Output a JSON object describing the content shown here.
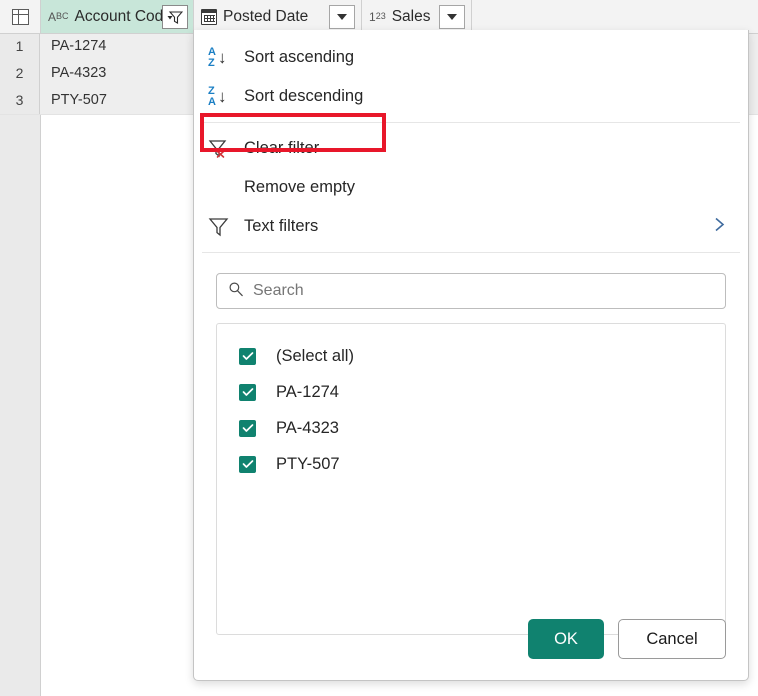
{
  "colors": {
    "accent_teal": "#10826f",
    "active_column_header": "#c8e6d9",
    "highlight_red": "#e8172a",
    "sort_letter_blue": "#1b7fc4",
    "clear_filter_x_red": "#d13438"
  },
  "grid": {
    "corner_icon": "table-icon",
    "columns": [
      {
        "type_icon": "abc-text-type-icon",
        "label": "Account Code",
        "button": "filter-funnel-dropdown",
        "active": true
      },
      {
        "type_icon": "calendar-date-type-icon",
        "label": "Posted Date",
        "button": "dropdown-caret",
        "active": false
      },
      {
        "type_icon": "123-number-type-icon",
        "label": "Sales",
        "button": "dropdown-caret",
        "active": false
      }
    ],
    "rows": [
      {
        "number": "1",
        "account_code": "PA-1274"
      },
      {
        "number": "2",
        "account_code": "PA-4323"
      },
      {
        "number": "3",
        "account_code": "PTY-507"
      }
    ]
  },
  "filter_panel": {
    "menu": [
      {
        "icon": "sort-ascending-icon",
        "label": "Sort ascending",
        "letters_top": "A",
        "letters_bottom": "Z",
        "arrow": "↓"
      },
      {
        "icon": "sort-descending-icon",
        "label": "Sort descending",
        "letters_top": "Z",
        "letters_bottom": "A",
        "arrow": "↓"
      },
      {
        "icon": "clear-filter-icon",
        "label": "Clear filter",
        "highlighted": true
      },
      {
        "icon": "none",
        "label": "Remove empty"
      },
      {
        "icon": "funnel-icon",
        "label": "Text filters",
        "submenu_chevron": "›"
      }
    ],
    "search": {
      "icon": "search-icon",
      "placeholder": "Search",
      "value": ""
    },
    "values": [
      {
        "label": "(Select all)",
        "checked": true
      },
      {
        "label": "PA-1274",
        "checked": true
      },
      {
        "label": "PA-4323",
        "checked": true
      },
      {
        "label": "PTY-507",
        "checked": true
      }
    ],
    "buttons": {
      "ok": "OK",
      "cancel": "Cancel"
    }
  }
}
